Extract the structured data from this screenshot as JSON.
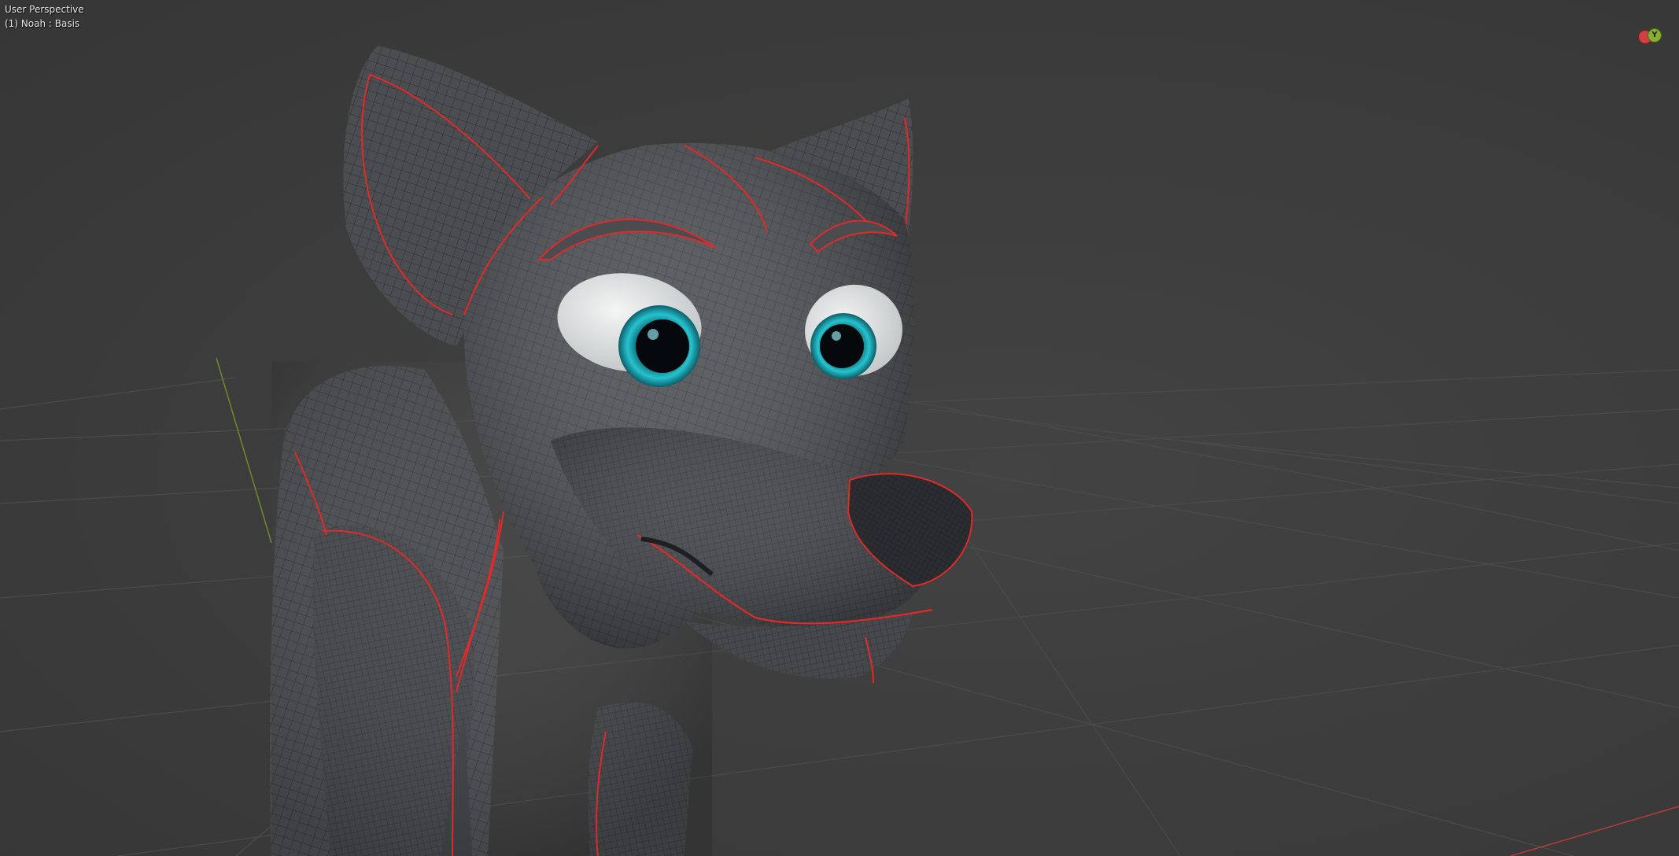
{
  "viewport": {
    "title": "User Perspective",
    "object_info": "(1) Noah : Basis"
  },
  "gizmo": {
    "y_label": "Y",
    "x_color": "#d04040",
    "y_color": "#88b030"
  },
  "colors": {
    "background": "#3d3d3d",
    "grid_line": "#4a4a4a",
    "x_axis": "#b83a3a",
    "y_axis": "#6f8a2a",
    "mesh_body": "#4a4c50",
    "mesh_wire": "#2f3134",
    "seam": "#e02a2a",
    "eye_white": "#e8eaea",
    "iris": "#1fb3c0",
    "pupil": "#0a0d10"
  },
  "icons": {
    "gizmo_x": "axis-x-dot",
    "gizmo_y": "axis-y-dot"
  }
}
